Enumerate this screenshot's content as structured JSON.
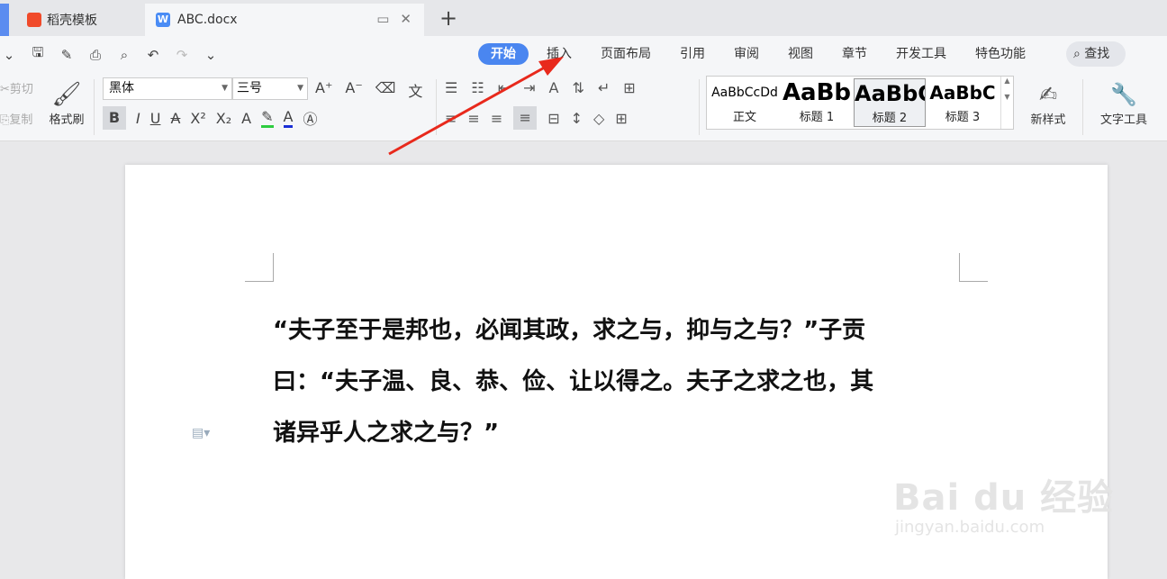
{
  "tabs": [
    {
      "label": "稻壳模板",
      "icon": "daoke-logo-icon"
    },
    {
      "label": "ABC.docx",
      "icon": "word-doc-icon"
    }
  ],
  "new_tab_symbol": "+",
  "menu": {
    "active": "开始",
    "items": [
      "插入",
      "页面布局",
      "引用",
      "审阅",
      "视图",
      "章节",
      "开发工具",
      "特色功能"
    ],
    "search": "查找"
  },
  "clipboard": {
    "cut": "剪切",
    "copy": "复制",
    "format_painter": "格式刷"
  },
  "font": {
    "name": "黑体",
    "size": "三号"
  },
  "styles": [
    {
      "preview": "AaBbCcDd",
      "name": "正文"
    },
    {
      "preview": "AaBb",
      "name": "标题 1"
    },
    {
      "preview": "AaBbC",
      "name": "标题 2"
    },
    {
      "preview": "AaBbC",
      "name": "标题 3"
    }
  ],
  "new_style": "新样式",
  "text_tools": "文字工具",
  "document": {
    "lines": [
      "“夫子至于是邦也，必闻其政，求之与，抑与之与？”子贡",
      "曰：“夫子温、良、恭、俭、让以得之。夫子之求之也，其",
      "诸异乎人之求之与？”"
    ]
  },
  "watermark": {
    "logo": "Bai du 经验",
    "url": "jingyan.baidu.com"
  },
  "colors": {
    "accent": "#4a86f0",
    "arrow": "#e8291c"
  }
}
